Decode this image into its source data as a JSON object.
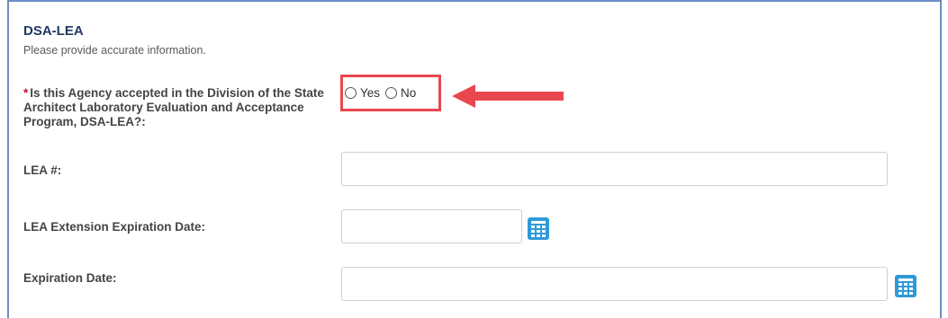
{
  "section": {
    "title": "DSA-LEA",
    "subtitle": "Please provide accurate information."
  },
  "question": {
    "required_mark": "*",
    "label": "Is this Agency accepted in the Division of the State Architect Laboratory Evaluation and Acceptance Program, DSA-LEA?:",
    "options": [
      "Yes",
      "No"
    ]
  },
  "fields": {
    "lea_number_label": "LEA #:",
    "lea_number_value": "",
    "extension_label": "LEA Extension Expiration Date:",
    "extension_value": "",
    "expiration_label": "Expiration Date:",
    "expiration_value": ""
  },
  "colors": {
    "highlight": "#e8474f",
    "calendar": "#2f9ad8",
    "title": "#1f3864"
  },
  "icons": {
    "calendar": "calendar-icon",
    "arrow": "arrow-left-icon"
  }
}
